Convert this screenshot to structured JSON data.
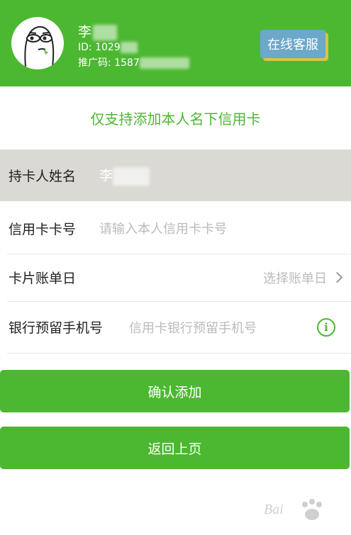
{
  "header": {
    "name": "李",
    "id_text": "ID: 1029",
    "promo_text": "推广码: 1587",
    "service_label": "在线客服"
  },
  "notice": "仅支持添加本人名下信用卡",
  "form": {
    "holder_label": "持卡人姓名",
    "holder_value": "李",
    "card_label": "信用卡卡号",
    "card_placeholder": "请输入本人信用卡卡号",
    "bill_label": "卡片账单日",
    "bill_placeholder": "选择账单日",
    "phone_label": "银行预留手机号",
    "phone_placeholder": "信用卡银行预留手机号"
  },
  "buttons": {
    "confirm_label": "确认添加",
    "back_label": "返回上页"
  },
  "watermark": "Bai",
  "colors": {
    "brand_green": "#4cb831",
    "service_blue": "#6ba8c9",
    "holder_bg": "#dad9d4",
    "placeholder": "#bbbbbb"
  }
}
